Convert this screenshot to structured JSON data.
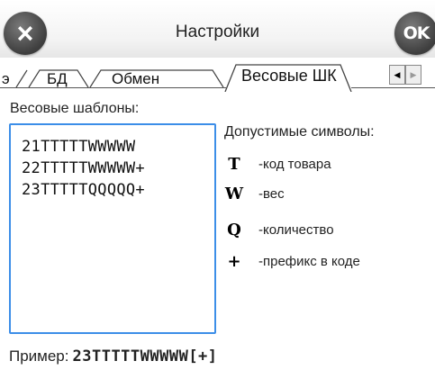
{
  "header": {
    "title": "Настройки",
    "close_icon": "×",
    "ok_label": "OK"
  },
  "tabs": [
    {
      "label": "э"
    },
    {
      "label": "БД"
    },
    {
      "label": "Обмен"
    },
    {
      "label": "Весовые ШК",
      "active": true
    }
  ],
  "tab_scroll": {
    "left": "◀",
    "right": "▶"
  },
  "content": {
    "templates_label": "Весовые шаблоны:",
    "templates": [
      "21TTTTTWWWWW",
      "22TTTTTWWWWW+",
      "23TTTTTQQQQQ+"
    ],
    "allowed_title": "Допустимые символы:",
    "symbols": [
      {
        "symbol": "T",
        "desc": "-код товара"
      },
      {
        "symbol": "W",
        "desc": "-вес"
      },
      {
        "symbol": "Q",
        "desc": "-количество"
      },
      {
        "symbol": "+",
        "desc": "-префикс в коде"
      }
    ],
    "example_label": "Пример:",
    "example_value": "23TTTTTWWWWW[+]"
  },
  "colors": {
    "focus_border": "#3c8ee8",
    "header_button": "#4a4a4a"
  }
}
